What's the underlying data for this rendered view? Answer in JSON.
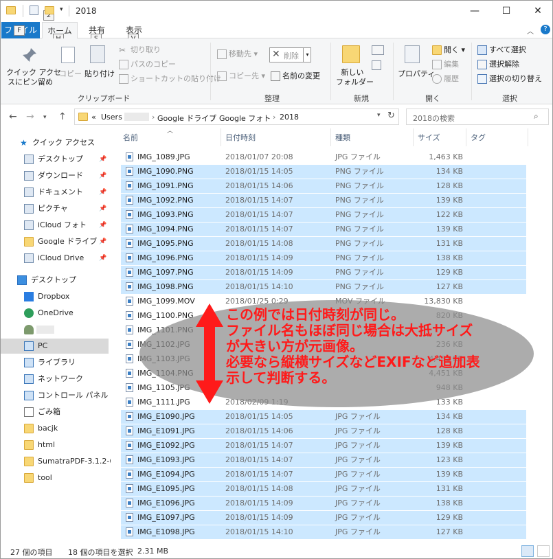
{
  "window": {
    "title": "2018",
    "keytip_quick": "2",
    "min_glyph": "—",
    "max_glyph": "☐",
    "close_glyph": "✕"
  },
  "ribbon_tabs": {
    "file": "ファイル",
    "home": "ホーム",
    "share": "共有",
    "view": "表示",
    "keytip_file": "F",
    "keytip_home": "H",
    "keytip_share": "S",
    "keytip_view": "V"
  },
  "ribbon": {
    "pin_quick_access": [
      "クイック アクセ",
      "スにピン留め"
    ],
    "copy": "コピー",
    "paste": "貼り付け",
    "cut": "切り取り",
    "copy_path": "パスのコピー",
    "paste_shortcut": "ショートカットの貼り付け",
    "clipboard_group": "クリップボード",
    "move_to": "移動先",
    "copy_to": "コピー先",
    "delete": "削除",
    "rename": "名前の変更",
    "organize_group": "整理",
    "new_folder": [
      "新しい",
      "フォルダー"
    ],
    "new_group": "新規",
    "properties": "プロパティ",
    "open": "開く",
    "edit": "編集",
    "history": "履歴",
    "open_group": "開く",
    "select_all": "すべて選択",
    "select_none": "選択解除",
    "invert_selection": "選択の切り替え",
    "select_group": "選択"
  },
  "address": {
    "prefix": "«",
    "crumbs": [
      "Users",
      "Google ドライブ",
      "Google フォト",
      "2018"
    ],
    "separator": "›",
    "search_placeholder": "2018の検索"
  },
  "nav_pane": {
    "quick_access": "クイック アクセス",
    "items": [
      {
        "label": "デスクトップ",
        "icon": "desktop-icon",
        "pinned": true
      },
      {
        "label": "ダウンロード",
        "icon": "download-icon",
        "pinned": true
      },
      {
        "label": "ドキュメント",
        "icon": "document-icon",
        "pinned": true
      },
      {
        "label": "ピクチャ",
        "icon": "picture-icon",
        "pinned": true
      },
      {
        "label": "iCloud フォト",
        "icon": "icloud-photos-icon",
        "pinned": true
      },
      {
        "label": "Google ドライブ",
        "icon": "folder-icon",
        "pinned": true
      },
      {
        "label": "iCloud Drive",
        "icon": "icloud-drive-icon",
        "pinned": true
      }
    ],
    "desktop": "デスクトップ",
    "tree": [
      {
        "label": "Dropbox",
        "icon": "dropbox-icon"
      },
      {
        "label": "OneDrive",
        "icon": "onedrive-icon"
      },
      {
        "label": "",
        "icon": "user-icon"
      },
      {
        "label": "PC",
        "icon": "pc-icon"
      },
      {
        "label": "ライブラリ",
        "icon": "library-icon"
      },
      {
        "label": "ネットワーク",
        "icon": "network-icon"
      },
      {
        "label": "コントロール パネル",
        "icon": "control-panel-icon"
      },
      {
        "label": "ごみ箱",
        "icon": "recycle-bin-icon"
      },
      {
        "label": "bacjk",
        "icon": "folder-icon"
      },
      {
        "label": "html",
        "icon": "folder-icon"
      },
      {
        "label": "SumatraPDF-3.1.2-6",
        "icon": "folder-icon"
      },
      {
        "label": "tool",
        "icon": "folder-icon"
      }
    ]
  },
  "columns": {
    "name": "名前",
    "date": "日付時刻",
    "type": "種類",
    "size": "サイズ",
    "tags": "タグ"
  },
  "files": [
    {
      "name": "IMG_1089.JPG",
      "date": "2018/01/07 20:08",
      "type": "JPG ファイル",
      "size": "1,463 KB",
      "selected": false
    },
    {
      "name": "IMG_1090.PNG",
      "date": "2018/01/15 14:05",
      "type": "PNG ファイル",
      "size": "134 KB",
      "selected": true
    },
    {
      "name": "IMG_1091.PNG",
      "date": "2018/01/15 14:06",
      "type": "PNG ファイル",
      "size": "128 KB",
      "selected": true
    },
    {
      "name": "IMG_1092.PNG",
      "date": "2018/01/15 14:07",
      "type": "PNG ファイル",
      "size": "139 KB",
      "selected": true
    },
    {
      "name": "IMG_1093.PNG",
      "date": "2018/01/15 14:07",
      "type": "PNG ファイル",
      "size": "122 KB",
      "selected": true
    },
    {
      "name": "IMG_1094.PNG",
      "date": "2018/01/15 14:07",
      "type": "PNG ファイル",
      "size": "139 KB",
      "selected": true
    },
    {
      "name": "IMG_1095.PNG",
      "date": "2018/01/15 14:08",
      "type": "PNG ファイル",
      "size": "131 KB",
      "selected": true
    },
    {
      "name": "IMG_1096.PNG",
      "date": "2018/01/15 14:09",
      "type": "PNG ファイル",
      "size": "138 KB",
      "selected": true
    },
    {
      "name": "IMG_1097.PNG",
      "date": "2018/01/15 14:09",
      "type": "PNG ファイル",
      "size": "129 KB",
      "selected": true
    },
    {
      "name": "IMG_1098.PNG",
      "date": "2018/01/15 14:10",
      "type": "PNG ファイル",
      "size": "127 KB",
      "selected": true
    },
    {
      "name": "IMG_1099.MOV",
      "date": "2018/01/25 0:29",
      "type": "MOV ファイル",
      "size": "13,830 KB",
      "selected": false
    },
    {
      "name": "IMG_1100.PNG",
      "date": "",
      "type": "",
      "size": "820 KB",
      "selected": false
    },
    {
      "name": "IMG_1101.PNG",
      "date": "",
      "type": "",
      "size": "",
      "selected": false
    },
    {
      "name": "IMG_1102.JPG",
      "date": "",
      "type": "",
      "size": "236 KB",
      "selected": false
    },
    {
      "name": "IMG_1103.JPG",
      "date": "",
      "type": "",
      "size": "4,451 KB",
      "selected": false
    },
    {
      "name": "IMG_1104.PNG",
      "date": "",
      "type": "",
      "size": "4,451 KB",
      "selected": false
    },
    {
      "name": "IMG_1105.JPG",
      "date": "",
      "type": "",
      "size": "948 KB",
      "selected": false
    },
    {
      "name": "IMG_1111.JPG",
      "date": "2018/02/09 1:19",
      "type": "",
      "size": "133 KB",
      "selected": false
    },
    {
      "name": "IMG_E1090.JPG",
      "date": "2018/01/15 14:05",
      "type": "JPG ファイル",
      "size": "134 KB",
      "selected": true
    },
    {
      "name": "IMG_E1091.JPG",
      "date": "2018/01/15 14:06",
      "type": "JPG ファイル",
      "size": "128 KB",
      "selected": true
    },
    {
      "name": "IMG_E1092.JPG",
      "date": "2018/01/15 14:07",
      "type": "JPG ファイル",
      "size": "139 KB",
      "selected": true
    },
    {
      "name": "IMG_E1093.JPG",
      "date": "2018/01/15 14:07",
      "type": "JPG ファイル",
      "size": "123 KB",
      "selected": true
    },
    {
      "name": "IMG_E1094.JPG",
      "date": "2018/01/15 14:07",
      "type": "JPG ファイル",
      "size": "139 KB",
      "selected": true
    },
    {
      "name": "IMG_E1095.JPG",
      "date": "2018/01/15 14:08",
      "type": "JPG ファイル",
      "size": "131 KB",
      "selected": true
    },
    {
      "name": "IMG_E1096.JPG",
      "date": "2018/01/15 14:09",
      "type": "JPG ファイル",
      "size": "138 KB",
      "selected": true
    },
    {
      "name": "IMG_E1097.JPG",
      "date": "2018/01/15 14:09",
      "type": "JPG ファイル",
      "size": "129 KB",
      "selected": true
    },
    {
      "name": "IMG_E1098.JPG",
      "date": "2018/01/15 14:10",
      "type": "JPG ファイル",
      "size": "127 KB",
      "selected": true
    }
  ],
  "annotation": {
    "lines": [
      "この例では日付時刻が同じ。",
      "ファイル名もほぼ同じ場合は大抵サイズ",
      "が大きい方が元画像。",
      "必要なら縦横サイズなどEXIFなど追加表",
      "示して判断する。"
    ],
    "color": "#ff1a1a"
  },
  "status": {
    "item_count": "27 個の項目",
    "selected": "18 個の項目を選択",
    "selected_size": "2.31 MB"
  },
  "colors": {
    "accent": "#1979ca",
    "selection": "#cce8ff",
    "annotation": "#ff1a1a"
  }
}
